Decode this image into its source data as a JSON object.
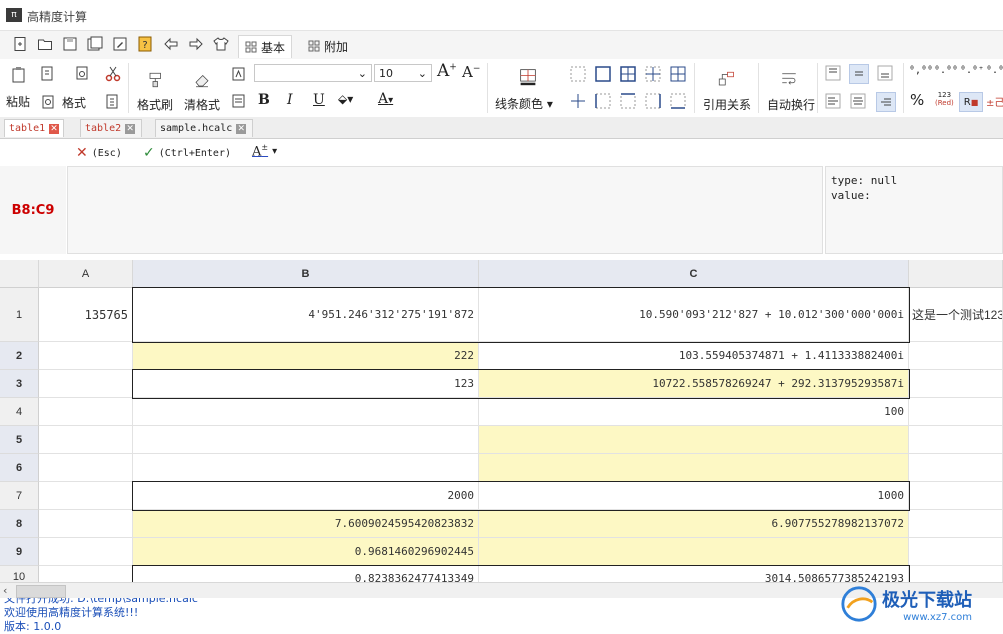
{
  "window": {
    "title": "高精度计算",
    "app_icon_text": "π"
  },
  "ribbon_tabs": [
    {
      "label": "基本"
    },
    {
      "label": "附加"
    }
  ],
  "ribbon": {
    "paste_label": "粘贴",
    "format_label": "格式",
    "format_painter_label": "格式刷",
    "clear_format_label": "清格式",
    "font_name": "",
    "font_size": "10",
    "bold": "B",
    "italic": "I",
    "underline": "U",
    "line_color_label": "线条颜色",
    "reference_label": "引用关系",
    "wrap_label": "自动换行",
    "percent": "%",
    "precision_top": "123",
    "precision_bottom": "(Red)",
    "format_r": "R",
    "format_cut": "±己"
  },
  "doc_tabs": [
    {
      "label": "table1",
      "active": true
    },
    {
      "label": "table2",
      "active": false
    },
    {
      "label": "sample.hcalc",
      "active": false
    }
  ],
  "formula_bar": {
    "cancel_label": "(Esc)",
    "confirm_label": "(Ctrl+Enter)",
    "cell_ref": "B8:C9",
    "type_info": "type: null\nvalue:",
    "formula": ""
  },
  "grid": {
    "columns": [
      "A",
      "B",
      "C"
    ],
    "rows": [
      {
        "num": "1",
        "A": "135765",
        "B": "4'951.246'312'275'191'872",
        "C": "10.590'093'212'827 + 10.012'300'000'000i",
        "D": "这是一个测试123"
      },
      {
        "num": "2",
        "A": "",
        "B": "222",
        "C": "103.559405374871 + 1.411333882400i",
        "D": ""
      },
      {
        "num": "3",
        "A": "",
        "B": "123",
        "C": "10722.558578269247 + 292.313795293587i",
        "D": ""
      },
      {
        "num": "4",
        "A": "",
        "B": "",
        "C": "100",
        "D": ""
      },
      {
        "num": "5",
        "A": "",
        "B": "",
        "C": "",
        "D": ""
      },
      {
        "num": "6",
        "A": "",
        "B": "",
        "C": "",
        "D": ""
      },
      {
        "num": "7",
        "A": "",
        "B": "2000",
        "C": "1000",
        "D": ""
      },
      {
        "num": "8",
        "A": "",
        "B": "7.6009024595420823832",
        "C": "6.907755278982137072",
        "D": ""
      },
      {
        "num": "9",
        "A": "",
        "B": "0.9681460296902445",
        "C": "",
        "D": ""
      },
      {
        "num": "10",
        "A": "",
        "B": "0.8238362477413349",
        "C": "3014.5086577385242193",
        "D": ""
      }
    ]
  },
  "log": [
    "文件打开成功: D:\\temp\\sample.hcalc",
    "欢迎使用高精度计算系统!!!",
    "版本: 1.0.0"
  ],
  "watermark": {
    "text": "极光下载站",
    "url": "www.xz7.com"
  },
  "colors": {
    "yellow_cell": "#fdf8c4",
    "selection_header": "#e6e9f1",
    "log_text": "#1b4fb8",
    "active_ref": "#cc0000"
  }
}
